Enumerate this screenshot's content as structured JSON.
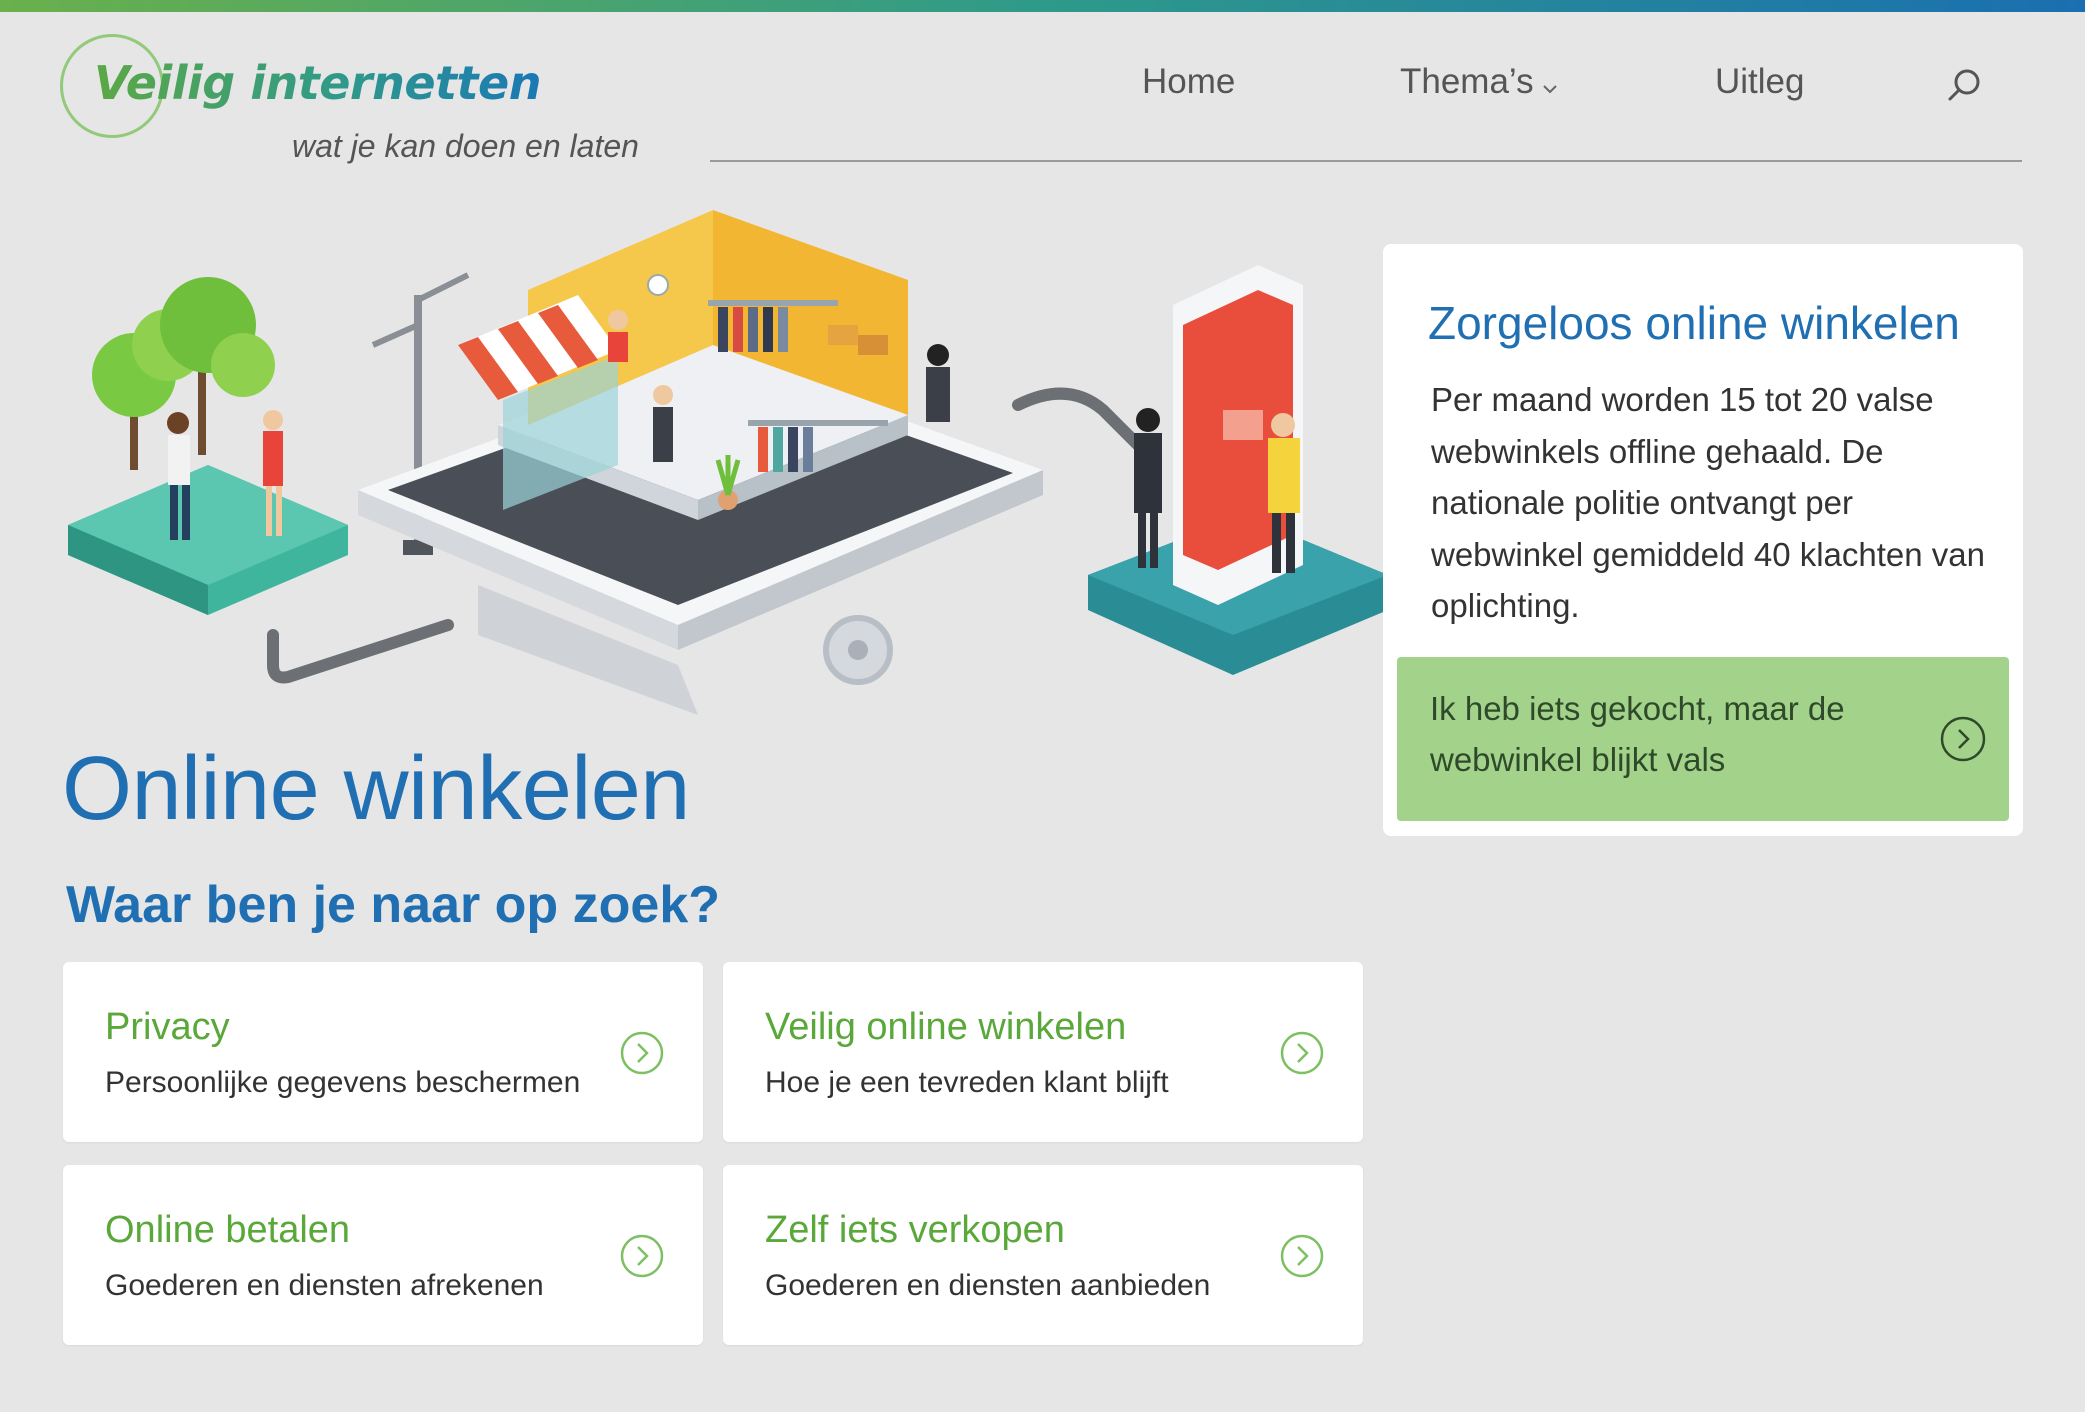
{
  "site": {
    "logo_title": "Veilig internetten",
    "logo_tagline": "wat je kan doen en laten"
  },
  "nav": {
    "items": [
      {
        "label": "Home"
      },
      {
        "label": "Thema’s"
      },
      {
        "label": "Uitleg"
      }
    ],
    "search_icon": "search-icon"
  },
  "colors": {
    "accent_blue": "#1f6fb2",
    "accent_green": "#5aa83a",
    "cta_green": "#a3d38b",
    "background": "#e6e6e6"
  },
  "main": {
    "title": "Online winkelen",
    "subtitle": "Waar ben je naar op zoek?",
    "cards": [
      {
        "title": "Privacy",
        "subtitle": "Persoonlijke gegevens beschermen"
      },
      {
        "title": "Veilig online winkelen",
        "subtitle": "Hoe je een tevreden klant blijft"
      },
      {
        "title": "Online betalen",
        "subtitle": "Goederen en diensten afrekenen"
      },
      {
        "title": "Zelf iets verkopen",
        "subtitle": "Goederen en diensten aanbieden"
      }
    ]
  },
  "info_panel": {
    "title": "Zorgeloos online winkelen",
    "body": "Per maand worden 15 tot 20 valse webwinkels offline gehaald. De nationale politie ontvangt per webwinkel gemiddeld 40 klachten van oplichting.",
    "cta": "Ik heb iets gekocht, maar de webwinkel blijkt vals"
  }
}
